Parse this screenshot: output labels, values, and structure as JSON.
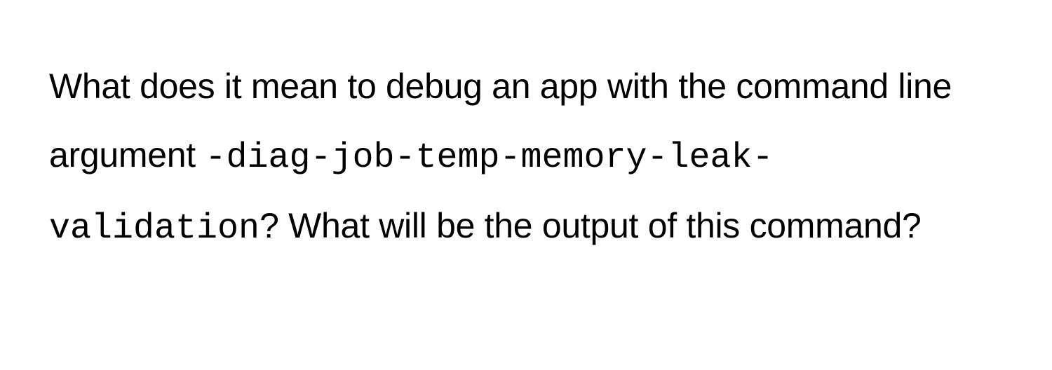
{
  "paragraph": {
    "part1": "What does it mean to debug an app with the command line argument ",
    "code1": "-diag-job-temp-memory-leak-validation",
    "part2": "? What will be the output of this command?"
  }
}
